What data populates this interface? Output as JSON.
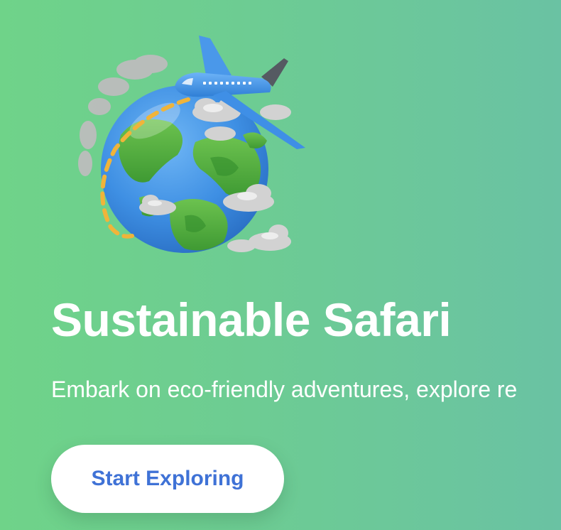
{
  "hero": {
    "title": "Sustainable Safari",
    "subtitle": "Embark on eco-friendly adventures, explore re",
    "cta_label": "Start Exploring"
  },
  "illustration": {
    "icon": "globe-airplane-icon",
    "colors": {
      "ocean": "#3e8fe3",
      "land": "#4caf3e",
      "cloud": "#c9c9c9",
      "plane": "#3f8fe6",
      "path": "#f0b43a"
    }
  },
  "colors": {
    "background_start": "#6fd389",
    "background_end": "#6ac2a3",
    "title": "#ffffff",
    "button_bg": "#ffffff",
    "button_text": "#3f72d6"
  }
}
